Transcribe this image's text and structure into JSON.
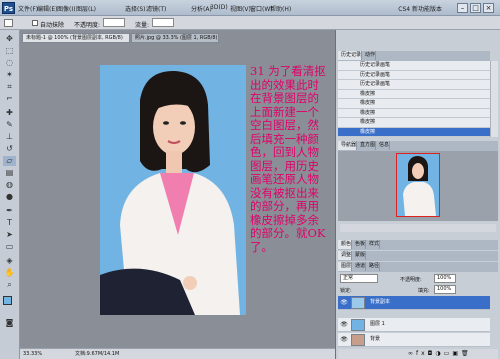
{
  "app": {
    "logo": "Ps",
    "workspace": "CS4 新功能版本"
  },
  "menu": [
    "文件(F)",
    "编辑(E)",
    "图像(I)",
    "图层(L)",
    "选择(S)",
    "滤镜(T)",
    "分析(A)",
    "3D(D)",
    "视图(V)",
    "窗口(W)",
    "帮助(H)"
  ],
  "options": {
    "auto_erase": "自动抹除",
    "opacity_label": "不透明度:",
    "flow_label": "流量:"
  },
  "doc": {
    "tab": "未标题-1 @ 100% (背景图层副本, RGB/8)",
    "tab2": "照片.jpg @ 33.3% (图层 1, RGB/8)"
  },
  "note": "31 为了看清抠出的效果此时在背景图层的上面新建一个空白图层，然后填充一种颜色，回到人物图层，用历史画笔还原人物没有被抠出来的部分，再用橡皮擦掉多余的部分。就OK了。",
  "status": {
    "zoom": "33.33%",
    "info": "文档:9.67M/14.1M"
  },
  "history": {
    "tabs": [
      "历史记录",
      "动作"
    ],
    "rows": [
      "历史记录画笔",
      "历史记录画笔",
      "历史记录画笔",
      "橡皮擦",
      "橡皮擦",
      "橡皮擦",
      "橡皮擦",
      "橡皮擦"
    ]
  },
  "navigator": {
    "tabs": [
      "导航器",
      "直方图",
      "信息"
    ]
  },
  "panels": {
    "color_tabs": [
      "颜色",
      "色板",
      "样式"
    ],
    "adjust_tabs": [
      "调整",
      "蒙版"
    ]
  },
  "layers": {
    "tabs": [
      "图层",
      "通道",
      "路径"
    ],
    "blend": "正常",
    "opacity_label": "不透明度:",
    "opacity": "100%",
    "fill_label": "填充:",
    "fill": "100%",
    "lock_label": "锁定:",
    "rows": [
      {
        "name": "背景副本",
        "selected": true
      },
      {
        "name": "图层 1",
        "selected": false
      },
      {
        "name": "背景",
        "selected": false
      }
    ]
  },
  "colors": {
    "accent": "#3a6fc9",
    "canvas_bg": "#71b4e4",
    "note": "#e0006a"
  }
}
